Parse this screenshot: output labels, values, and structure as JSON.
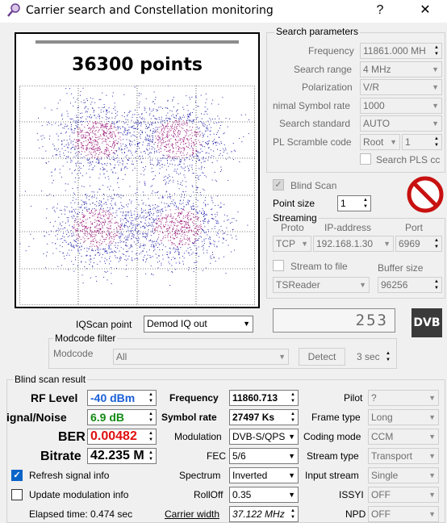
{
  "window": {
    "title": "Carrier search and Constellation monitoring",
    "help": "?",
    "close": "✕"
  },
  "plot": {
    "points_label": "36300 points"
  },
  "search": {
    "title": "Search parameters",
    "frequency": {
      "label": "Frequency",
      "value": "11861.000 MH"
    },
    "range": {
      "label": "Search range",
      "value": "4 MHz"
    },
    "polarization": {
      "label": "Polarization",
      "value": "V/R"
    },
    "symbol_rate": {
      "label": "nimal Symbol rate",
      "value": "1000"
    },
    "standard": {
      "label": "Search standard",
      "value": "AUTO"
    },
    "pl_scramble": {
      "label": "PL Scramble code",
      "value": "Root",
      "value2": "1"
    },
    "search_pls": {
      "label": "Search PLS cc"
    }
  },
  "blind": {
    "label": "Blind Scan",
    "point_size_label": "Point size",
    "point_size": "1"
  },
  "streaming": {
    "title": "Streaming",
    "proto_label": "Proto",
    "ip_label": "IP-address",
    "port_label": "Port",
    "proto": "TCP",
    "ip": "192.168.1.30",
    "port": "6969",
    "stream_to_file": "Stream to file",
    "buffer_label": "Buffer size",
    "reader": "TSReader",
    "buffer": "96256"
  },
  "counter": "253",
  "dvb_logo": "DVB",
  "iqscan": {
    "label": "IQScan point",
    "value": "Demod IQ out"
  },
  "modcode": {
    "title": "Modcode filter",
    "label": "Modcode",
    "value": "All",
    "detect": "Detect",
    "timeout": "3 sec"
  },
  "result": {
    "title": "Blind scan result",
    "rf_label": "RF Level",
    "rf_value": "-40 dBm",
    "snr_label": "ignal/Noise",
    "snr_value": "6.9 dB",
    "ber_label": "BER",
    "ber_value": "0.00482",
    "bitrate_label": "Bitrate",
    "bitrate_value": "42.235 M",
    "freq_label": "Frequency",
    "freq_value": "11860.713",
    "sr_label": "Symbol rate",
    "sr_value": "27497 Ks",
    "mod_label": "Modulation",
    "mod_value": "DVB-S/QPS",
    "fec_label": "FEC",
    "fec_value": "5/6",
    "spectrum_label": "Spectrum",
    "spectrum_value": "Inverted",
    "rolloff_label": "RollOff",
    "rolloff_value": "0.35",
    "cw_label": "Carrier width",
    "cw_value": "37.122 MHz",
    "pilot_label": "Pilot",
    "pilot_value": "?",
    "frame_label": "Frame type",
    "frame_value": "Long",
    "coding_label": "Coding mode",
    "coding_value": "CCM",
    "stype_label": "Stream type",
    "stype_value": "Transport",
    "istream_label": "Input stream",
    "istream_value": "Single",
    "issyi_label": "ISSYI",
    "issyi_value": "OFF",
    "npd_label": "NPD",
    "npd_value": "OFF"
  },
  "refresh": {
    "label": "Refresh signal info"
  },
  "update": {
    "label": "Update modulation info"
  },
  "elapsed": "Elapsed time: 0.474 sec",
  "colors": {
    "rf": "#1a5fd6",
    "snr": "#138a13",
    "ber": "#e01010",
    "scatter": "#2222aa",
    "scatter_core": "#9b1a7a"
  }
}
